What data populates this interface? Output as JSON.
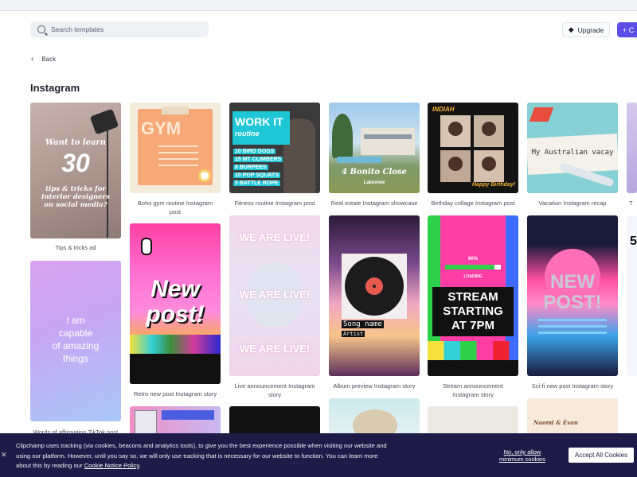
{
  "search": {
    "placeholder": "Search templates"
  },
  "header": {
    "upgrade_label": "Upgrade",
    "create_label": "C"
  },
  "nav": {
    "back_label": "Back"
  },
  "section": {
    "title": "Instagram"
  },
  "templates": {
    "c1": {
      "caption": "Tips & tricks ad",
      "l1": "Want to learn",
      "l2": "30",
      "l3": "tips & tricks for",
      "l4": "interior designers",
      "l5": "on social media?"
    },
    "c2": {
      "caption1": "Boho gym routine Instagram",
      "caption2": "post",
      "title": "GYM"
    },
    "c3": {
      "caption": "Fitness routine Instagram post",
      "title1": "WORK IT",
      "title2": "routine",
      "items": [
        "10 BIRD DOGS",
        "15 MT CLIMBERS",
        "8 BURPEES",
        "10 POP SQUATS",
        "5 BATTLE ROPE"
      ]
    },
    "c4": {
      "caption": "Real estate Instagram showcase",
      "name": "4 Bonito Close",
      "sub": "Lakeview"
    },
    "c5": {
      "caption": "Birthday collage Instagram post",
      "name": "INDIAH",
      "bday": "Happy Birthday!"
    },
    "c6": {
      "caption": "Vacation Instagram recap",
      "title": "My Australian vacay"
    },
    "c7": {
      "caption": "Words of affirmation TikTok post",
      "l1": "I am",
      "l2": "capable",
      "l3": "of amazing",
      "l4": "things"
    },
    "c8": {
      "caption": "Retro new post Instagram story",
      "l1": "New",
      "l2": "post!"
    },
    "c9": {
      "caption1": "Live announcement Instagram",
      "caption2": "story",
      "line": "WE ARE LIVE!"
    },
    "c10": {
      "caption": "Album preview Instagram story",
      "song": "Song name",
      "artist": "Artist"
    },
    "c11": {
      "caption1": "Stream announcement",
      "caption2": "Instagram story",
      "pct": "90%",
      "loading": "LOADING",
      "l1": "STREAM",
      "l2": "STARTING",
      "l3": "AT 7PM"
    },
    "c12": {
      "caption": "Sci-fi new post Instagram story",
      "l1": "NEW",
      "l2": "POST!"
    },
    "c13": {
      "names": "Naomi & Evan"
    },
    "edge1": {
      "caption": "T"
    },
    "edge2": {
      "title": "5"
    }
  },
  "cookie": {
    "text": "Clipchamp uses tracking (via cookies, beacons and analytics tools), to give you the best experience possible when visiting our website and using our platform. However, until you say so, we will only use tracking that is necessary for our website to function. You can learn more about this by reading our ",
    "link": "Cookie Notice Policy",
    "period": ".",
    "only_allow": "No, only allow minimum cookies",
    "accept": "Accept All Cookies",
    "close": "✕"
  }
}
